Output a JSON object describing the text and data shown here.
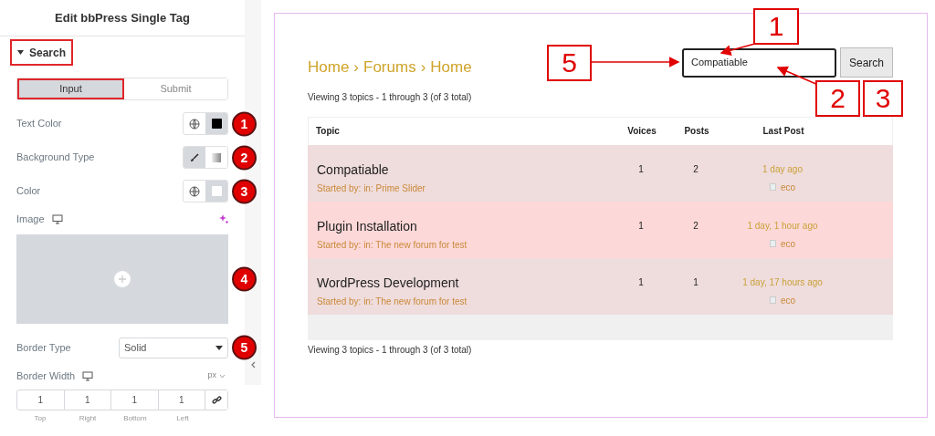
{
  "panel": {
    "title": "Edit bbPress Single Tag",
    "section": {
      "label": "Search",
      "expanded": true,
      "highlighted": true
    },
    "tabs": [
      {
        "label": "Input",
        "selected": true,
        "highlighted": true
      },
      {
        "label": "Submit",
        "selected": false,
        "highlighted": false
      }
    ],
    "controls": [
      {
        "kind": "color",
        "label": "Text Color",
        "color": "#000000",
        "marker": "1"
      },
      {
        "kind": "choice",
        "label": "Background Type",
        "options": [
          {
            "kind": "classic",
            "selected": true
          },
          {
            "kind": "gradient",
            "selected": false
          }
        ],
        "marker": "2"
      },
      {
        "kind": "color",
        "label": "Color",
        "color": "#ffffff",
        "marker": "3"
      },
      {
        "kind": "image",
        "label": "Image",
        "marker": "4"
      },
      {
        "kind": "select",
        "label": "Border Type",
        "value": "Solid",
        "marker": "5"
      },
      {
        "kind": "dimensions",
        "label": "Border Width",
        "unit": "px",
        "fields": [
          {
            "value": "1",
            "label": "Top"
          },
          {
            "value": "1",
            "label": "Right"
          },
          {
            "value": "1",
            "label": "Bottom"
          },
          {
            "value": "1",
            "label": "Left"
          }
        ],
        "linked": true
      }
    ]
  },
  "preview": {
    "breadcrumb": [
      "Home",
      "Forums",
      "Home"
    ],
    "separator": "›",
    "search": {
      "value": "Compatiable",
      "button": "Search"
    },
    "summary_top": "Viewing 3 topics - 1 through 3 (of 3 total)",
    "columns": [
      "Topic",
      "Voices",
      "Posts",
      "Last Post"
    ],
    "rows": [
      {
        "title": "Compatiable",
        "meta": "Started by: in: Prime Slider",
        "voices": "1",
        "posts": "2",
        "last_post": "1 day ago",
        "author": "eco",
        "color": "#efdcdc"
      },
      {
        "title": "Plugin Installation",
        "meta": "Started by: in: The new forum for test",
        "voices": "1",
        "posts": "2",
        "last_post": "1 day, 1 hour ago",
        "author": "eco",
        "color": "#fdd8d8"
      },
      {
        "title": "WordPress Development",
        "meta": "Started by: in: The new forum for test",
        "voices": "1",
        "posts": "1",
        "last_post": "1 day, 17 hours ago",
        "author": "eco",
        "color": "#efdcdc"
      }
    ],
    "summary_bottom": "Viewing 3 topics - 1 through 3 (of 3 total)"
  },
  "callouts": [
    {
      "label": "1",
      "kind": "top"
    },
    {
      "label": "5",
      "kind": "left"
    },
    {
      "label": "2",
      "kind": "bottom"
    },
    {
      "label": "3",
      "kind": "plain"
    }
  ]
}
